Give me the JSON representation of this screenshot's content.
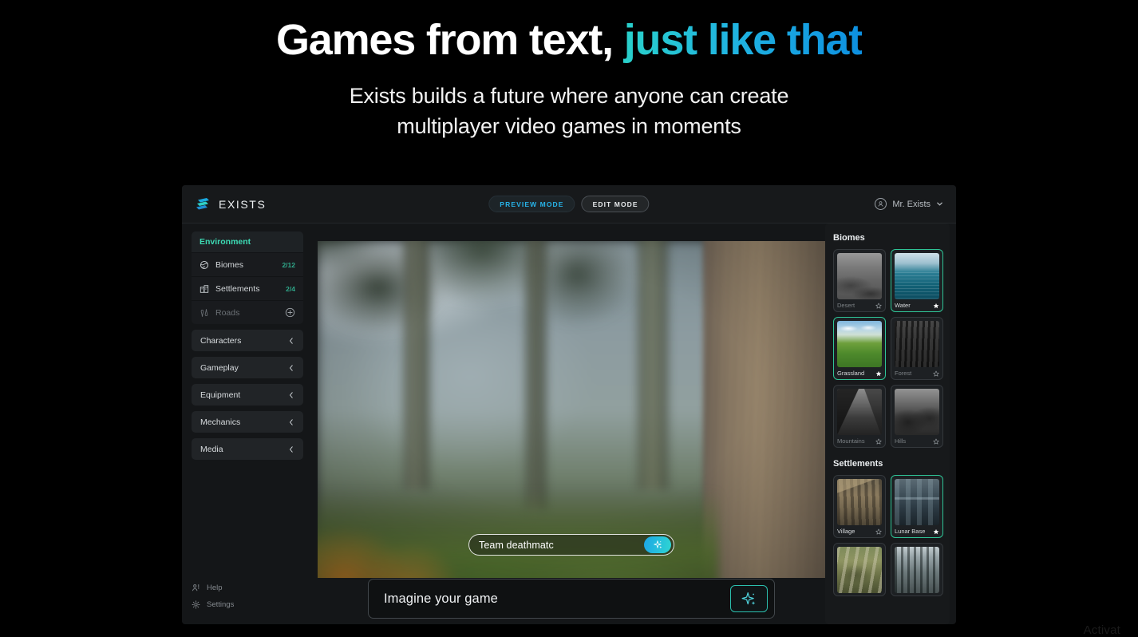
{
  "hero": {
    "headline_white": "Games from text,",
    "headline_accent": " just like that",
    "subline_line1": "Exists builds a future where anyone can create",
    "subline_line2": "multiplayer video games in moments"
  },
  "colors": {
    "accent_teal": "#2fc496",
    "accent_cyan": "#27b3e8",
    "gradient_start": "#2ad3c8",
    "gradient_end": "#0d8fe0",
    "panel_bg": "#17191b",
    "app_bg": "#141618"
  },
  "topbar": {
    "brand": "EXISTS",
    "brand_icon": "exists-logo-icon",
    "preview_mode": "PREVIEW MODE",
    "edit_mode": "EDIT MODE",
    "account_name": "Mr. Exists",
    "account_icon": "user-circle-icon",
    "chevron_icon": "chevron-down-icon"
  },
  "sidebar": {
    "group_title": "Environment",
    "rows": [
      {
        "label": "Biomes",
        "count": "2/12",
        "icon": "globe-icon",
        "muted": false,
        "action": ""
      },
      {
        "label": "Settlements",
        "count": "2/4",
        "icon": "buildings-icon",
        "muted": false,
        "action": ""
      },
      {
        "label": "Roads",
        "count": "",
        "icon": "road-icon",
        "muted": true,
        "action": "plus-circle-icon"
      }
    ],
    "collapsed": [
      {
        "label": "Characters",
        "icon": "chevron-left-icon"
      },
      {
        "label": "Gameplay",
        "icon": "chevron-left-icon"
      },
      {
        "label": "Equipment",
        "icon": "chevron-left-icon"
      },
      {
        "label": "Mechanics",
        "icon": "chevron-left-icon"
      },
      {
        "label": "Media",
        "icon": "chevron-left-icon"
      }
    ],
    "footer": [
      {
        "label": "Help",
        "icon": "help-person-icon"
      },
      {
        "label": "Settings",
        "icon": "gear-icon"
      }
    ]
  },
  "viewport": {
    "scene_description": "blurred foggy forest with large tree trunk",
    "overlay_input_value": "Team deathmatc",
    "overlay_button_icon": "sparkle-icon"
  },
  "prompt": {
    "placeholder": "Imagine your game",
    "value": "",
    "button_icon": "sparkle-icon"
  },
  "rightpanel": {
    "sections": [
      {
        "title": "Biomes",
        "items": [
          {
            "name": "Desert",
            "art": "art-desert",
            "selected": false,
            "grayscale": true,
            "favorite": false,
            "star_icon": "star-outline-icon"
          },
          {
            "name": "Water",
            "art": "art-water",
            "selected": true,
            "grayscale": false,
            "favorite": true,
            "star_icon": "star-filled-icon"
          },
          {
            "name": "Grassland",
            "art": "art-grass",
            "selected": true,
            "grayscale": false,
            "favorite": true,
            "star_icon": "star-filled-icon"
          },
          {
            "name": "Forest",
            "art": "art-forest",
            "selected": false,
            "grayscale": true,
            "favorite": false,
            "star_icon": "star-outline-icon"
          },
          {
            "name": "Mountains",
            "art": "art-mount",
            "selected": false,
            "grayscale": true,
            "favorite": false,
            "star_icon": "star-outline-icon"
          },
          {
            "name": "Hills",
            "art": "art-hills",
            "selected": false,
            "grayscale": true,
            "favorite": false,
            "star_icon": "star-outline-icon"
          }
        ]
      },
      {
        "title": "Settlements",
        "items": [
          {
            "name": "Village",
            "art": "art-village",
            "selected": false,
            "grayscale": false,
            "favorite": false,
            "star_icon": "star-outline-icon"
          },
          {
            "name": "Lunar Base",
            "art": "art-lunar",
            "selected": true,
            "grayscale": false,
            "favorite": true,
            "star_icon": "star-filled-icon"
          },
          {
            "name": "",
            "art": "art-camp",
            "selected": false,
            "grayscale": false,
            "favorite": false,
            "star_icon": ""
          },
          {
            "name": "",
            "art": "art-town",
            "selected": false,
            "grayscale": false,
            "favorite": false,
            "star_icon": ""
          }
        ]
      }
    ]
  },
  "watermark": {
    "text": "Activat"
  }
}
